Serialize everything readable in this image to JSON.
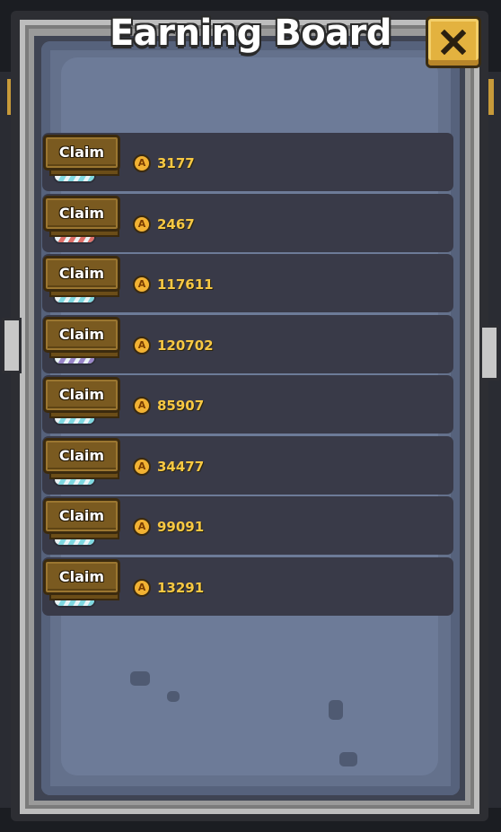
{
  "title": "Earning Board",
  "close": {
    "icon": "close-icon"
  },
  "currency_icon": "coin-icon",
  "currency_glyph": "A",
  "claim_label": "Claim",
  "rows": [
    {
      "claim_label": "Claim",
      "amount": "3177",
      "pet_color": "#7fd8e0"
    },
    {
      "claim_label": "Claim",
      "amount": "2467",
      "pet_color": "#e0706b"
    },
    {
      "claim_label": "Claim",
      "amount": "117611",
      "pet_color": "#7fd8e0"
    },
    {
      "claim_label": "Claim",
      "amount": "120702",
      "pet_color": "#9a86c9"
    },
    {
      "claim_label": "Claim",
      "amount": "85907",
      "pet_color": "#7fd8e0"
    },
    {
      "claim_label": "Claim",
      "amount": "34477",
      "pet_color": "#7fd8e0"
    },
    {
      "claim_label": "Claim",
      "amount": "99091",
      "pet_color": "#7fd8e0"
    },
    {
      "claim_label": "Claim",
      "amount": "13291",
      "pet_color": "#7fd8e0"
    }
  ],
  "colors": {
    "board": "#64718c",
    "row": "#393a48",
    "amount": "#f7c843",
    "claim_button": "#7a5a20",
    "close_button": "#e3b23f"
  }
}
